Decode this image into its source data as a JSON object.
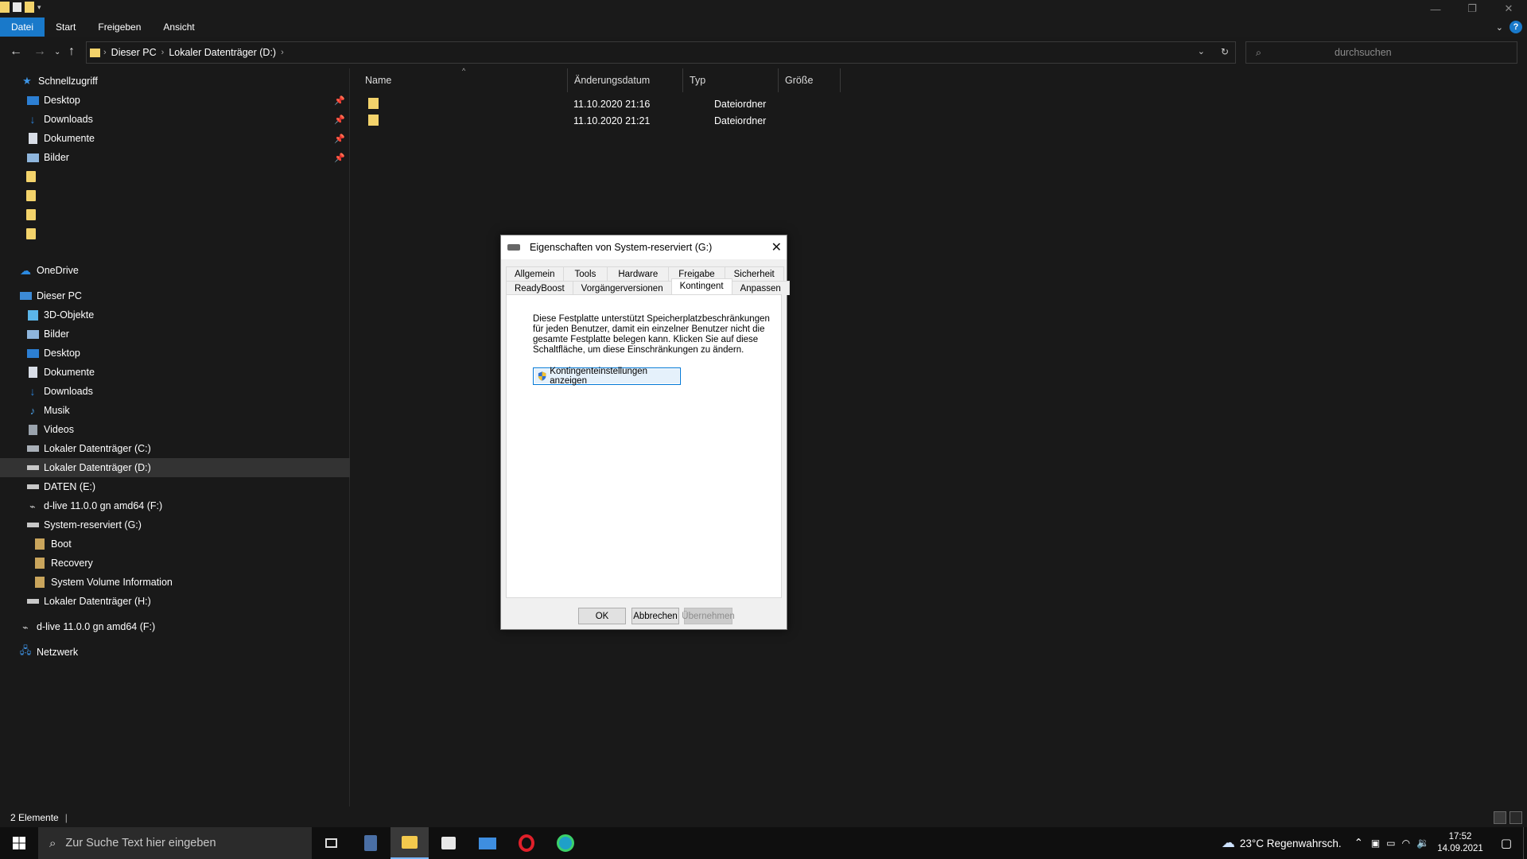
{
  "ribbon": {
    "tabs": [
      "Datei",
      "Start",
      "Freigeben",
      "Ansicht"
    ]
  },
  "address": {
    "crumbs": [
      "Dieser PC",
      "Lokaler Datenträger (D:)"
    ],
    "search_placeholder": "durchsuchen"
  },
  "sidebar": {
    "quick_access": "Schnellzugriff",
    "pinned": [
      "Desktop",
      "Downloads",
      "Dokumente",
      "Bilder"
    ],
    "onedrive": "OneDrive",
    "this_pc": "Dieser PC",
    "pc_items": [
      "3D-Objekte",
      "Bilder",
      "Desktop",
      "Dokumente",
      "Downloads",
      "Musik",
      "Videos",
      "Lokaler Datenträger (C:)",
      "Lokaler Datenträger (D:)",
      "DATEN (E:)",
      "d-live 11.0.0 gn amd64 (F:)",
      "System-reserviert (G:)"
    ],
    "g_children": [
      "Boot",
      "Recovery",
      "System Volume Information"
    ],
    "after_g": "Lokaler Datenträger (H:)",
    "usb": "d-live 11.0.0 gn amd64 (F:)",
    "network": "Netzwerk"
  },
  "columns": [
    "Name",
    "Änderungsdatum",
    "Typ",
    "Größe"
  ],
  "files": [
    {
      "date": "11.10.2020 21:16",
      "type": "Dateiordner"
    },
    {
      "date": "11.10.2020 21:21",
      "type": "Dateiordner"
    }
  ],
  "status": {
    "count": "2 Elemente"
  },
  "dialog": {
    "title": "Eigenschaften von System-reserviert (G:)",
    "tabs_top": [
      "Allgemein",
      "Tools",
      "Hardware",
      "Freigabe",
      "Sicherheit"
    ],
    "tabs_bottom": [
      "ReadyBoost",
      "Vorgängerversionen",
      "Kontingent",
      "Anpassen"
    ],
    "text_lines": [
      "Diese Festplatte unterstützt Speicherplatzbeschränkungen",
      "für jeden Benutzer, damit ein einzelner Benutzer nicht die",
      "gesamte Festplatte belegen kann. Klicken Sie auf diese",
      "Schaltfläche, um diese Einschränkungen zu ändern."
    ],
    "quota_button": "Kontingenteinstellungen anzeigen",
    "ok": "OK",
    "cancel": "Abbrechen",
    "apply": "Übernehmen"
  },
  "taskbar": {
    "search_placeholder": "Zur Suche Text hier eingeben",
    "weather": "23°C  Regenwahrsch.",
    "time": "17:52",
    "date": "14.09.2021"
  },
  "colors": {
    "accent": "#1979ca",
    "folder": "#f3d36b",
    "dark_bg": "#191919"
  }
}
